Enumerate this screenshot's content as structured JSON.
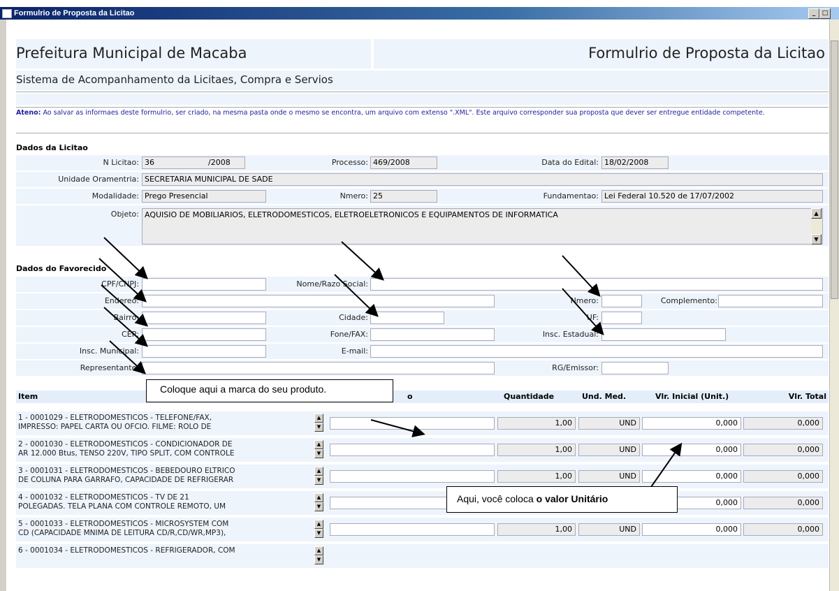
{
  "window": {
    "title": "Formulrio de Proposta da Licitao",
    "minimize": "_",
    "maximize": "□"
  },
  "header": {
    "org": "Prefeitura Municipal de Macaba",
    "form_title": "Formulrio de Proposta da Licitao",
    "subtitle": "Sistema de Acompanhamento da Licitaes, Compra e Servios"
  },
  "notice": {
    "label": "Ateno:",
    "text": " Ao salvar as informaes deste formulrio, ser criado, na mesma pasta onde o mesmo se encontra, um arquivo com extenso \".XML\". Este arquivo corresponder sua proposta que dever ser entregue  entidade competente."
  },
  "licitacao": {
    "section": "Dados da Licitao",
    "n_label": "N Licitao:",
    "n_value": "36",
    "year_value": "/2008",
    "processo_label": "Processo:",
    "processo_value": "469/2008",
    "data_label": "Data do Edital:",
    "data_value": "18/02/2008",
    "unidade_label": "Unidade Oramentria:",
    "unidade_value": "SECRETARIA MUNICIPAL DE SADE",
    "modalidade_label": "Modalidade:",
    "modalidade_value": "Prego Presencial",
    "numero_label": "Nmero:",
    "numero_value": "25",
    "fundamentacao_label": "Fundamentao:",
    "fundamentacao_value": "Lei Federal 10.520 de 17/07/2002",
    "objeto_label": "Objeto:",
    "objeto_value": "AQUISIO DE MOBILIARIOS, ELETRODOMESTICOS, ELETROELETRONICOS E EQUIPAMENTOS DE INFORMATICA"
  },
  "favorecido": {
    "section": "Dados do Favorecido",
    "cpf_label": "CPF/CNPJ:",
    "nome_label": "Nome/Razo Social:",
    "endereco_label": "Endereo:",
    "numero_label": "Nmero:",
    "complemento_label": "Complemento:",
    "bairro_label": "Bairro:",
    "cidade_label": "Cidade:",
    "uf_label": "UF:",
    "cep_label": "CEP:",
    "fone_label": "Fone/FAX:",
    "insc_estadual_label": "Insc. Estadual:",
    "insc_municipal_label": "Insc. Municipal:",
    "email_label": "E-mail:",
    "representante_label": "Representante:",
    "rg_label": "RG/Emissor:"
  },
  "table": {
    "headers": {
      "item": "Item",
      "marca": "o",
      "quantidade": "Quantidade",
      "und": "Und. Med.",
      "vlr_inicial": "Vlr. Inicial (Unit.)",
      "vlr_total": "Vlr. Total"
    },
    "rows": [
      {
        "line1": "1 - 0001029 - ELETRODOMESTICOS - TELEFONE/FAX,",
        "line2": "IMPRESSO: PAPEL CARTA OU OFCIO. FILME: ROLO DE",
        "qty": "1,00",
        "und": "UND",
        "unit": "0,000",
        "total": "0,000"
      },
      {
        "line1": "2 - 0001030 - ELETRODOMESTICOS - CONDICIONADOR DE",
        "line2": "AR 12.000 Btus, TENSO 220V, TIPO SPLIT, COM CONTROLE",
        "qty": "1,00",
        "und": "UND",
        "unit": "0,000",
        "total": "0,000"
      },
      {
        "line1": "3 - 0001031 - ELETRODOMESTICOS - BEBEDOURO ELTRICO",
        "line2": "DE COLUNA PARA GARRAFO, CAPACIDADE DE REFRIGERAR",
        "qty": "1,00",
        "und": "UND",
        "unit": "0,000",
        "total": "0,000"
      },
      {
        "line1": "4 - 0001032 - ELETRODOMESTICOS - TV DE 21",
        "line2": "POLEGADAS. TELA PLANA COM CONTROLE REMOTO, UM",
        "qty": "1,00",
        "und": "UND",
        "unit": "0,000",
        "total": "0,000"
      },
      {
        "line1": "5 - 0001033 - ELETRODOMESTICOS - MICROSYSTEM COM",
        "line2": "CD (CAPACIDADE MNIMA DE LEITURA CD/R,CD/WR,MP3),",
        "qty": "1,00",
        "und": "UND",
        "unit": "0,000",
        "total": "0,000"
      },
      {
        "line1": "6 - 0001034 - ELETRODOMESTICOS - REFRIGERADOR, COM",
        "line2": "",
        "qty": "",
        "und": "",
        "unit": "",
        "total": ""
      }
    ]
  },
  "callouts": {
    "marca": "Coloque aqui a marca do seu produto.",
    "valor_prefix": "Aqui, você coloca ",
    "valor_bold": "o valor Unitário"
  }
}
